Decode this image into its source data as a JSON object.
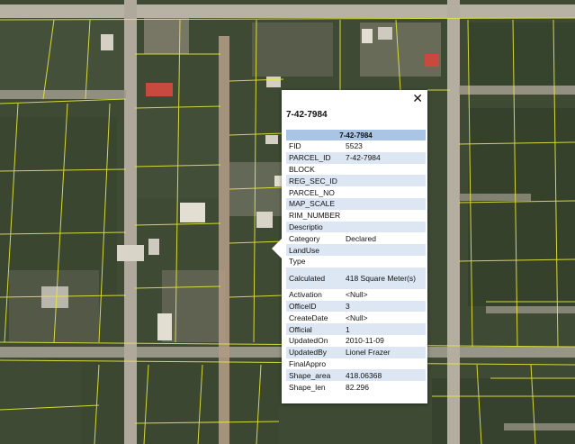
{
  "popup": {
    "title": "7-42-7984",
    "close_icon": "close-icon",
    "table_header": "7-42-7984",
    "rows": [
      {
        "field": "FID",
        "value": "5523"
      },
      {
        "field": "PARCEL_ID",
        "value": "7-42-7984"
      },
      {
        "field": "BLOCK",
        "value": ""
      },
      {
        "field": "REG_SEC_ID",
        "value": ""
      },
      {
        "field": "PARCEL_NO",
        "value": ""
      },
      {
        "field": "MAP_SCALE",
        "value": ""
      },
      {
        "field": "RIM_NUMBER",
        "value": ""
      },
      {
        "field": "Descriptio",
        "value": ""
      },
      {
        "field": "Category",
        "value": "Declared"
      },
      {
        "field": "LandUse",
        "value": ""
      },
      {
        "field": "Type",
        "value": ""
      },
      {
        "field": "Calculated",
        "value": "418 Square Meter(s)"
      },
      {
        "field": "Activation",
        "value": "<Null>"
      },
      {
        "field": "OfficeID",
        "value": "3"
      },
      {
        "field": "CreateDate",
        "value": "<Null>"
      },
      {
        "field": "Official",
        "value": "1"
      },
      {
        "field": "UpdatedOn",
        "value": "2010-11-09"
      },
      {
        "field": "UpdatedBy",
        "value": "Lionel Frazer"
      },
      {
        "field": "FinalAppro",
        "value": ""
      },
      {
        "field": "Shape_area",
        "value": "418.06368"
      },
      {
        "field": "Shape_len",
        "value": "82.296"
      }
    ]
  },
  "colors": {
    "table_header_bg": "#a9c4e4",
    "row_alt_bg": "#dde7f4",
    "parcel_line": "#e8e83a"
  }
}
